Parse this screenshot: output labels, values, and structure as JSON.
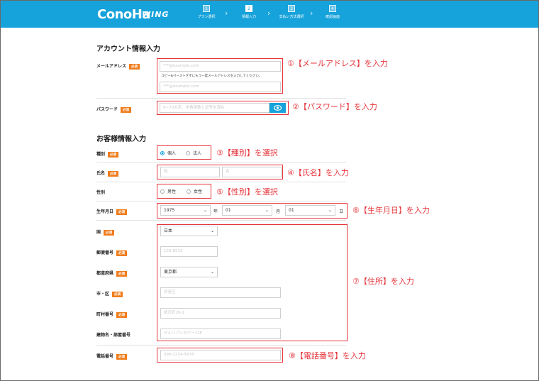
{
  "header": {
    "logo": "ConoHa",
    "logo_sub": "WING",
    "steps": [
      {
        "num": "1",
        "label": "プラン選択"
      },
      {
        "num": "2",
        "label": "情報入力"
      },
      {
        "num": "3",
        "label": "支払い方法選択"
      },
      {
        "num": "4",
        "label": "確認画面"
      }
    ],
    "active_step": 2,
    "color": "#16a2da"
  },
  "account_section": {
    "title": "アカウント情報入力",
    "email": {
      "label": "メールアドレス",
      "required_badge": "必須",
      "placeholder": "***@example.com",
      "note": "コピー&ペーストせずにもう一度メールアドレスを入力してください。",
      "confirm_placeholder": "***@example.com"
    },
    "password": {
      "label": "パスワード",
      "required_badge": "必須",
      "placeholder": "9~70文字、半角英数と記号を混在",
      "toggle_icon": "eye-icon"
    }
  },
  "customer_section": {
    "title": "お客様情報入力",
    "type": {
      "label": "種別",
      "required_badge": "必須",
      "options": [
        "個人",
        "法人"
      ],
      "selected": "個人"
    },
    "name": {
      "label": "氏名",
      "required_badge": "必須",
      "last_placeholder": "姓",
      "first_placeholder": "名"
    },
    "gender": {
      "label": "性別",
      "options": [
        "男性",
        "女性"
      ]
    },
    "birthdate": {
      "label": "生年月日",
      "required_badge": "必須",
      "year": "1975",
      "year_unit": "年",
      "month": "01",
      "month_unit": "月",
      "day": "01",
      "day_unit": "日"
    },
    "country": {
      "label": "国",
      "required_badge": "必須",
      "value": "日本"
    },
    "postal": {
      "label": "郵便番号",
      "required_badge": "必須",
      "placeholder": "150-8512"
    },
    "prefecture": {
      "label": "都道府県",
      "required_badge": "必須",
      "value": "東京都"
    },
    "city": {
      "label": "市・区",
      "required_badge": "必須",
      "placeholder": "渋谷区"
    },
    "street": {
      "label": "町村番号",
      "required_badge": "必須",
      "placeholder": "桜丘町26-1"
    },
    "building": {
      "label": "建物名・部屋番号",
      "placeholder": "セルリアンタワー11F"
    },
    "phone": {
      "label": "電話番号",
      "required_badge": "必須",
      "placeholder": "090-1234-5678"
    }
  },
  "annotations": {
    "color": "#e6343b",
    "items": [
      "①【メールアドレス】を入力",
      "②【パスワード】を入力",
      "③【種別】を選択",
      "④【氏名】を入力",
      "⑤【性別】を選択",
      "⑥【生年月日】を入力",
      "⑦【住所】を入力",
      "⑧【電話番号】を入力"
    ]
  },
  "colors": {
    "accent": "#16a2da",
    "required": "#f07c1b",
    "annotation": "#e6343b"
  }
}
